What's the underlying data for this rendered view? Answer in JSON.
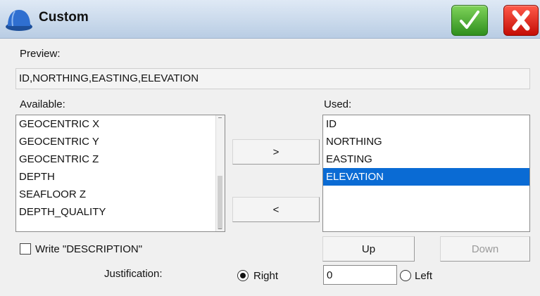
{
  "window": {
    "title": "Custom"
  },
  "preview": {
    "label": "Preview:",
    "value": "ID,NORTHING,EASTING,ELEVATION"
  },
  "available": {
    "label": "Available:",
    "items": [
      "GEOCENTRIC X",
      "GEOCENTRIC Y",
      "GEOCENTRIC Z",
      "DEPTH",
      "SEAFLOOR Z",
      "DEPTH_QUALITY"
    ]
  },
  "used": {
    "label": "Used:",
    "items": [
      "ID",
      "NORTHING",
      "EASTING",
      "ELEVATION"
    ],
    "selected_index": 3
  },
  "buttons": {
    "add": ">",
    "remove": "<",
    "up": "Up",
    "down": "Down"
  },
  "write_description": {
    "label": "Write \"DESCRIPTION\"",
    "checked": false
  },
  "justification": {
    "label": "Justification:",
    "right_label": "Right",
    "left_label": "Left",
    "selected": "Right",
    "value": "0"
  },
  "colors": {
    "selection": "#0a6bd4",
    "ok": "#3aa527",
    "close": "#e0150b"
  }
}
